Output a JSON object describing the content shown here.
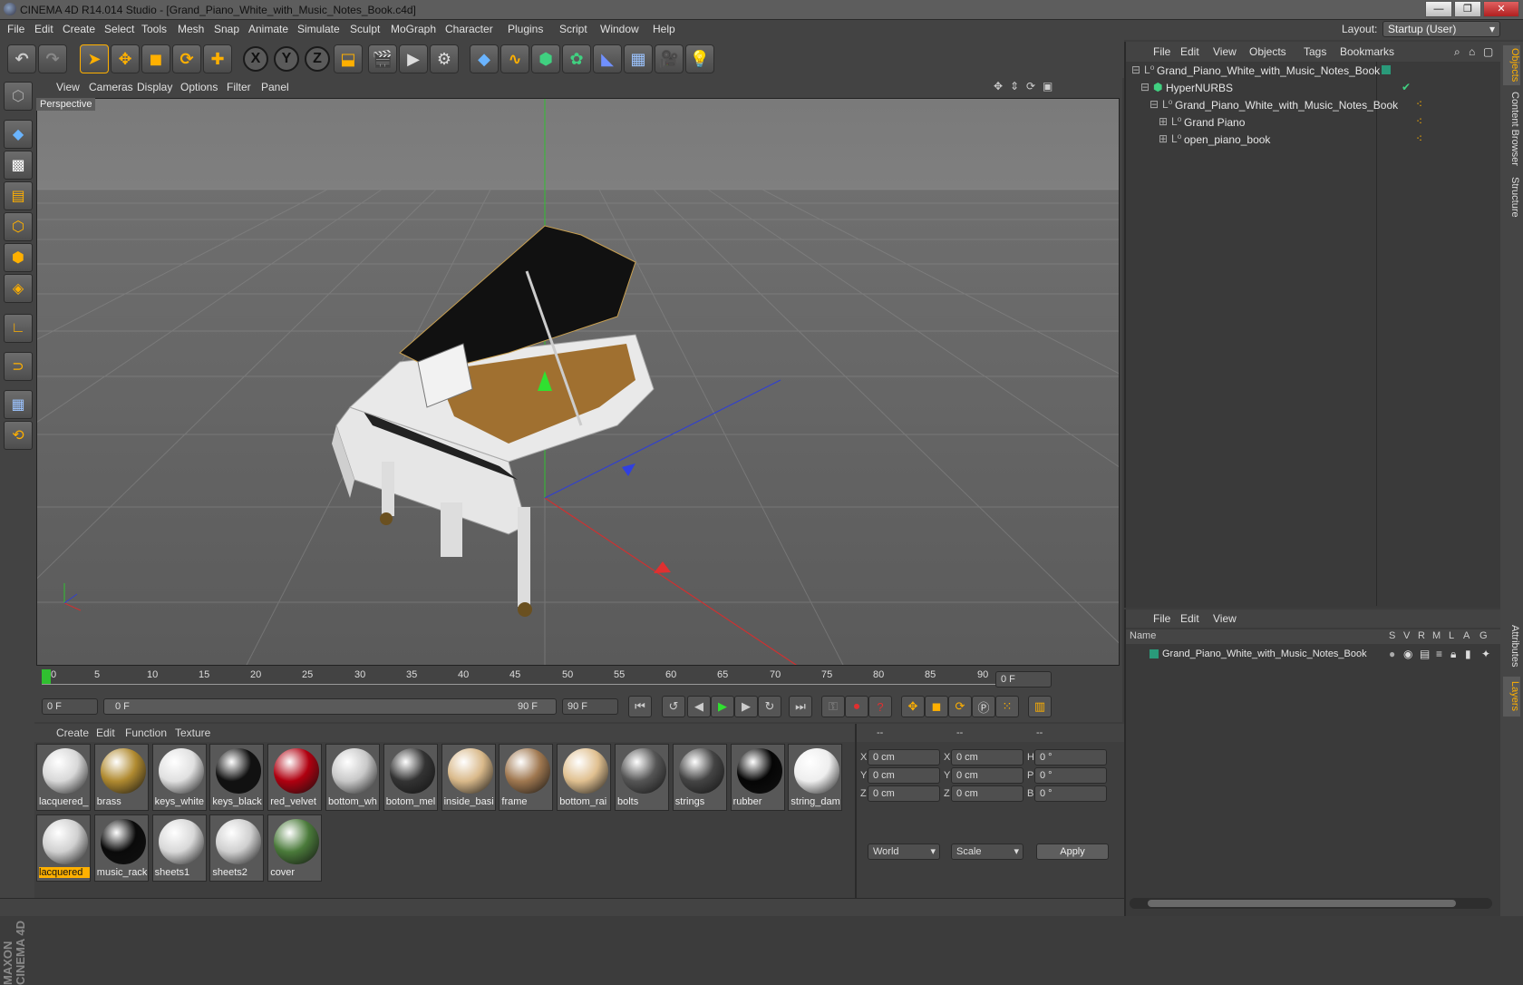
{
  "window": {
    "title": "CINEMA 4D R14.014 Studio - [Grand_Piano_White_with_Music_Notes_Book.c4d]",
    "min": "—",
    "max": "❐",
    "close": "✕"
  },
  "menu": [
    "File",
    "Edit",
    "Create",
    "Select",
    "Tools",
    "Mesh",
    "Snap",
    "Animate",
    "Simulate",
    "Sculpt",
    "MoGraph",
    "Character",
    "Plugins",
    "Script",
    "Window",
    "Help"
  ],
  "layout": {
    "label": "Layout:",
    "value": "Startup (User)"
  },
  "viewport": {
    "menu": [
      "View",
      "Cameras",
      "Display",
      "Options",
      "Filter",
      "Panel"
    ],
    "label": "Perspective"
  },
  "timeline": {
    "ticks": [
      "0",
      "5",
      "10",
      "15",
      "20",
      "25",
      "30",
      "35",
      "40",
      "45",
      "50",
      "55",
      "60",
      "65",
      "70",
      "75",
      "80",
      "85",
      "90"
    ],
    "current_frame": "0 F",
    "start": "0 F",
    "range_start": "0 F",
    "range_end": "90 F",
    "end": "90 F"
  },
  "materials": {
    "menu": [
      "Create",
      "Edit",
      "Function",
      "Texture"
    ],
    "items": [
      {
        "name": "lacquered_",
        "color": "#d8d8d8"
      },
      {
        "name": "brass",
        "color": "#b08a30"
      },
      {
        "name": "keys_white",
        "color": "#e0e0e0"
      },
      {
        "name": "keys_black",
        "color": "#111111"
      },
      {
        "name": "red_velvet",
        "color": "#b00010"
      },
      {
        "name": "bottom_wh",
        "color": "#c8c8c8"
      },
      {
        "name": "botom_mel",
        "color": "#333333"
      },
      {
        "name": "inside_basi",
        "color": "#d9b98a"
      },
      {
        "name": "frame",
        "color": "#a07850"
      },
      {
        "name": "bottom_rai",
        "color": "#e0c090"
      },
      {
        "name": "bolts",
        "color": "#555555"
      },
      {
        "name": "strings",
        "color": "#444444"
      },
      {
        "name": "rubber",
        "color": "#050505"
      },
      {
        "name": "string_dam",
        "color": "#eeeeee"
      },
      {
        "name": "lacquered",
        "color": "#d0d0d0"
      },
      {
        "name": "music_rack",
        "color": "#0a0a0a"
      },
      {
        "name": "sheets1",
        "color": "#d8d8d8"
      },
      {
        "name": "sheets2",
        "color": "#cfcfcf"
      },
      {
        "name": "cover",
        "color": "#4a7a3a"
      }
    ]
  },
  "coords": {
    "headers": [
      "--",
      "--",
      "--"
    ],
    "rows": [
      {
        "a": "X",
        "av": "0 cm",
        "b": "X",
        "bv": "0 cm",
        "c": "H",
        "cv": "0 °"
      },
      {
        "a": "Y",
        "av": "0 cm",
        "b": "Y",
        "bv": "0 cm",
        "c": "P",
        "cv": "0 °"
      },
      {
        "a": "Z",
        "av": "0 cm",
        "b": "Z",
        "bv": "0 cm",
        "c": "B",
        "cv": "0 °"
      }
    ],
    "world": "World",
    "scale": "Scale",
    "apply": "Apply"
  },
  "objects": {
    "menu": [
      "File",
      "Edit",
      "View",
      "Objects",
      "Tags",
      "Bookmarks"
    ],
    "tree": [
      {
        "name": "Grand_Piano_White_with_Music_Notes_Book"
      },
      {
        "name": "HyperNURBS"
      },
      {
        "name": "Grand_Piano_White_with_Music_Notes_Book"
      },
      {
        "name": "Grand Piano"
      },
      {
        "name": "open_piano_book"
      }
    ]
  },
  "layers": {
    "menu": [
      "File",
      "Edit",
      "View"
    ],
    "columns": [
      "Name",
      "S",
      "V",
      "R",
      "M",
      "L",
      "A",
      "G"
    ],
    "row": "Grand_Piano_White_with_Music_Notes_Book"
  },
  "sidetabs": [
    "Objects",
    "Content Browser",
    "Structure",
    "Attributes",
    "Layers"
  ],
  "brand": "MAXON CINEMA 4D",
  "colors": {
    "accent": "#ffb000",
    "axis_x": "#e03030",
    "axis_y": "#30d030",
    "axis_z": "#3050e0"
  }
}
